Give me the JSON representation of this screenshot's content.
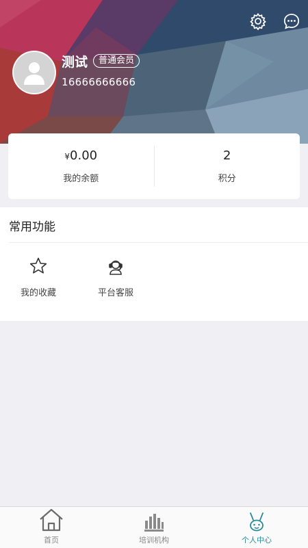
{
  "header": {
    "username": "测试",
    "member_badge": "普通会员",
    "phone": "16666666666"
  },
  "stats": {
    "balance": {
      "currency": "¥",
      "value": "0.00",
      "label": "我的余额"
    },
    "points": {
      "value": "2",
      "label": "积分"
    }
  },
  "functions": {
    "title": "常用功能",
    "items": [
      {
        "label": "我的收藏",
        "icon": "star-icon"
      },
      {
        "label": "平台客服",
        "icon": "customer-service-icon"
      }
    ]
  },
  "tabbar": {
    "items": [
      {
        "label": "首页",
        "icon": "home-icon",
        "active": false
      },
      {
        "label": "培训机构",
        "icon": "training-icon",
        "active": false
      },
      {
        "label": "个人中心",
        "icon": "profile-icon",
        "active": true
      }
    ],
    "active_color": "#2b8a9a"
  }
}
